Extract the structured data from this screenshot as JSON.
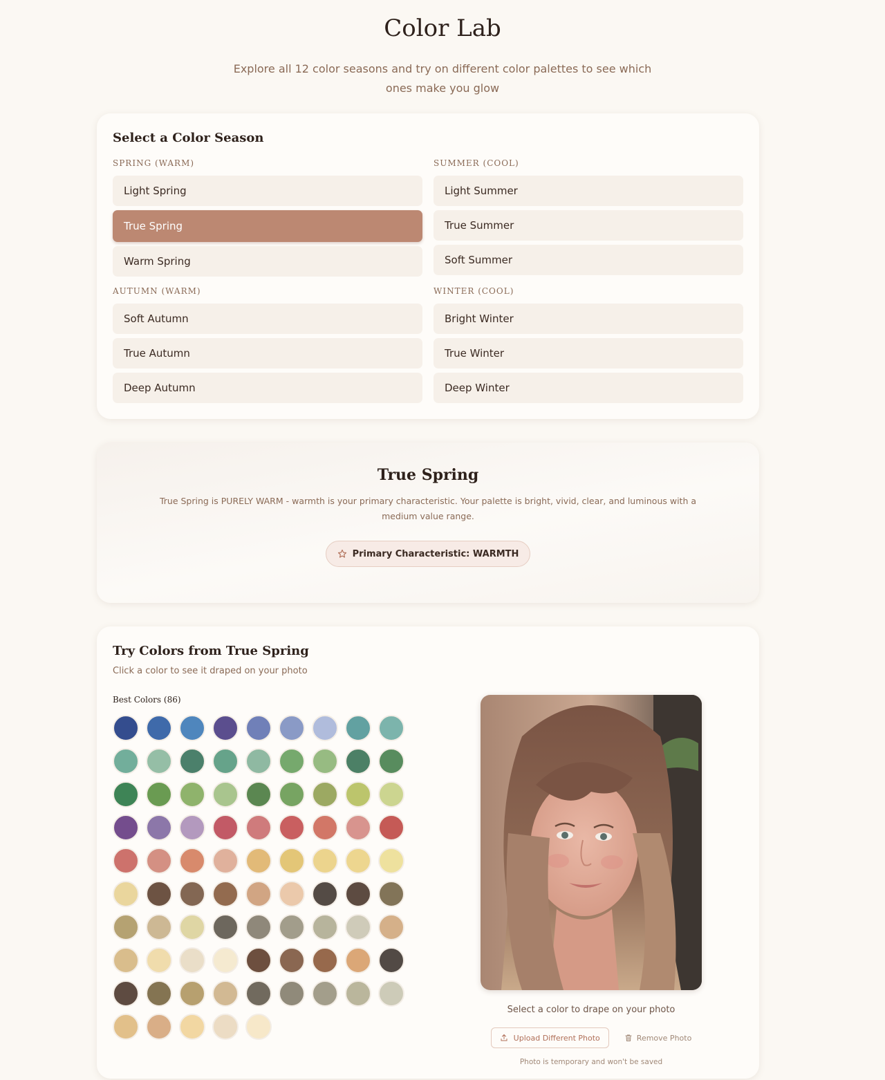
{
  "header": {
    "title": "Color Lab",
    "subtitle": "Explore all 12 color seasons and try on different color palettes to see which ones make you glow"
  },
  "selector": {
    "heading": "Select a Color Season",
    "groups": [
      {
        "label": "SPRING (WARM)",
        "items": [
          "Light Spring",
          "True Spring",
          "Warm Spring"
        ]
      },
      {
        "label": "SUMMER (COOL)",
        "items": [
          "Light Summer",
          "True Summer",
          "Soft Summer"
        ]
      },
      {
        "label": "AUTUMN (WARM)",
        "items": [
          "Soft Autumn",
          "True Autumn",
          "Deep Autumn"
        ]
      },
      {
        "label": "WINTER (COOL)",
        "items": [
          "Bright Winter",
          "True Winter",
          "Deep Winter"
        ]
      }
    ],
    "selected": "True Spring"
  },
  "description": {
    "title": "True Spring",
    "text": "True Spring is PURELY WARM - warmth is your primary characteristic. Your palette is bright, vivid, clear, and luminous with a medium value range.",
    "badge": "Primary Characteristic: WARMTH",
    "badge_icon": "star-icon"
  },
  "try": {
    "heading": "Try Colors from True Spring",
    "subheading": "Click a color to see it draped on your photo",
    "best_label": "Best Colors (86)",
    "drape_text": "Select a color to drape on your photo",
    "upload_label": "Upload Different Photo",
    "remove_label": "Remove Photo",
    "note": "Photo is temporary and won't be saved"
  },
  "colors": {
    "accent": "#bc8872",
    "swatches": [
      "#344d8e",
      "#3f6aaa",
      "#4f86bd",
      "#5b4e8e",
      "#7080b8",
      "#8a9ac6",
      "#b0bcdc",
      "#62a1a1",
      "#7cb4ac",
      "#72ae9b",
      "#95bea6",
      "#4b806b",
      "#66a38a",
      "#8fb9a2",
      "#76a96d",
      "#97bb82",
      "#4c8066",
      "#588c5e",
      "#3e8456",
      "#6a9b52",
      "#8fb36c",
      "#a9c58e",
      "#5b8751",
      "#77a462",
      "#9ca962",
      "#bcc56c",
      "#ccd590",
      "#744d8d",
      "#8c77a9",
      "#b399be",
      "#c25a66",
      "#cf7b7c",
      "#c95f60",
      "#d27767",
      "#d8948e",
      "#c55a56",
      "#cd726c",
      "#d49083",
      "#d88a6c",
      "#e0b19c",
      "#e2ba78",
      "#e3c677",
      "#ecd48d",
      "#edd68f",
      "#eee19e",
      "#ead69d",
      "#6d5343",
      "#836753",
      "#936b4f",
      "#d1a583",
      "#ebc9ab",
      "#544b45",
      "#5d4b41",
      "#827458",
      "#b5a272",
      "#cdb894",
      "#dfd6a4",
      "#6d675d",
      "#8f887a",
      "#a29d8b",
      "#b7b49c",
      "#cfcbb9",
      "#d5b089",
      "#d9bd8c",
      "#f0dcac",
      "#eadec8",
      "#f5ead0",
      "#6d4f3f",
      "#8a6751",
      "#97694c",
      "#dba777",
      "#524a45",
      "#5e4b41",
      "#847452",
      "#b7a06f",
      "#d2b993",
      "#716a5e",
      "#908a7a",
      "#a39e8b",
      "#bab69c",
      "#cdcbb8",
      "#e2c08a",
      "#d9ae87",
      "#f2d7a2",
      "#ecdcc4",
      "#f7e8c9"
    ]
  },
  "icons": {
    "upload": "upload-icon",
    "trash": "trash-icon"
  }
}
